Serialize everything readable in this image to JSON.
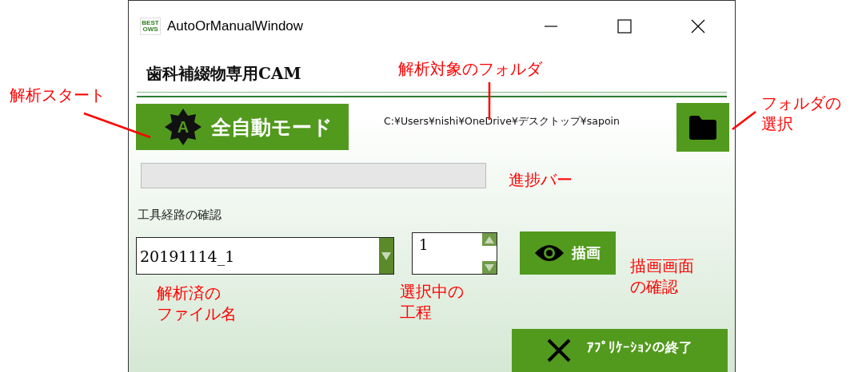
{
  "window": {
    "title": "AutoOrManualWindow",
    "logo_lines": [
      "BEST",
      "OWS"
    ]
  },
  "header": {
    "title": "歯科補綴物専用CAM"
  },
  "auto_button": {
    "badge": "A",
    "label": "全自動モード"
  },
  "folder_path": "C:¥Users¥nishi¥OneDrive¥デスクトップ¥sapoin",
  "progress": {
    "level": 0
  },
  "section_label": "工具経路の確認",
  "file_combo": {
    "value": "20191114_1"
  },
  "step_spinner": {
    "value": "1"
  },
  "draw_button": {
    "label": "描画"
  },
  "exit_button": {
    "label": "ｱﾌﾟﾘｹｰｼｮﾝの終了"
  },
  "annotations": [
    {
      "lines": [
        "解析スタート"
      ]
    },
    {
      "lines": [
        "解析対象のフォルダ"
      ]
    },
    {
      "lines": [
        "フォルダの",
        "選択"
      ]
    },
    {
      "lines": [
        "進捗バー"
      ]
    },
    {
      "lines": [
        "解析済の",
        "ファイル名"
      ]
    },
    {
      "lines": [
        "選択中の",
        "工程"
      ]
    },
    {
      "lines": [
        "描画画面",
        "の確認"
      ]
    }
  ]
}
